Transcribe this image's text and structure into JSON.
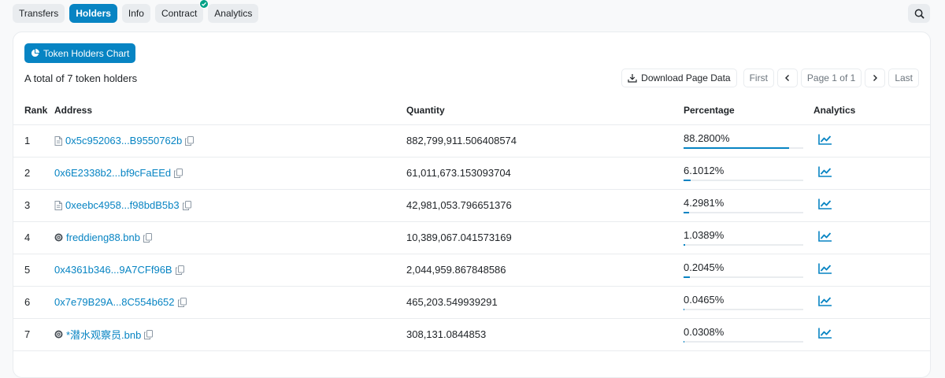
{
  "tabs": [
    {
      "label": "Transfers",
      "active": false
    },
    {
      "label": "Holders",
      "active": true
    },
    {
      "label": "Info",
      "active": false
    },
    {
      "label": "Contract",
      "active": false,
      "verified": true
    },
    {
      "label": "Analytics",
      "active": false
    }
  ],
  "chart_button": {
    "label": "Token Holders Chart"
  },
  "total_text": "A total of 7 token holders",
  "pagination": {
    "download_label": "Download Page Data",
    "first": "First",
    "page_label": "Page 1 of 1",
    "last": "Last"
  },
  "table": {
    "headers": {
      "rank": "Rank",
      "address": "Address",
      "quantity": "Quantity",
      "percentage": "Percentage",
      "analytics": "Analytics"
    },
    "rows": [
      {
        "rank": "1",
        "address": "0x5c952063...B9550762b",
        "icon": "contract",
        "quantity": "882,799,911.506408574",
        "percentage": "88.2800%",
        "fraction": 0.8828
      },
      {
        "rank": "2",
        "address": "0x6E2338b2...bf9cFaEEd",
        "icon": "none",
        "quantity": "61,011,673.153093704",
        "percentage": "6.1012%",
        "fraction": 0.061012
      },
      {
        "rank": "3",
        "address": "0xeebc4958...f98bdB5b3",
        "icon": "contract",
        "quantity": "42,981,053.796651376",
        "percentage": "4.2981%",
        "fraction": 0.042981
      },
      {
        "rank": "4",
        "address": "freddieng88.bnb",
        "icon": "ens",
        "quantity": "10,389,067.041573169",
        "percentage": "1.0389%",
        "fraction": 0.010389
      },
      {
        "rank": "5",
        "address": "0x4361b346...9A7CFf96B",
        "icon": "none",
        "quantity": "2,044,959.867848586",
        "percentage": "0.2045%",
        "fraction": 0.002045
      },
      {
        "rank": "6",
        "address": "0x7e79B29A...8C554b652",
        "icon": "none",
        "quantity": "465,203.549939291",
        "percentage": "0.0465%",
        "fraction": 0.000465
      },
      {
        "rank": "7",
        "address": "*潜水观察员.bnb",
        "icon": "ens",
        "quantity": "308,131.0844853",
        "percentage": "0.0308%",
        "fraction": 0.000308
      }
    ]
  },
  "colors": {
    "accent": "#0784c3",
    "verified": "#00a186"
  }
}
